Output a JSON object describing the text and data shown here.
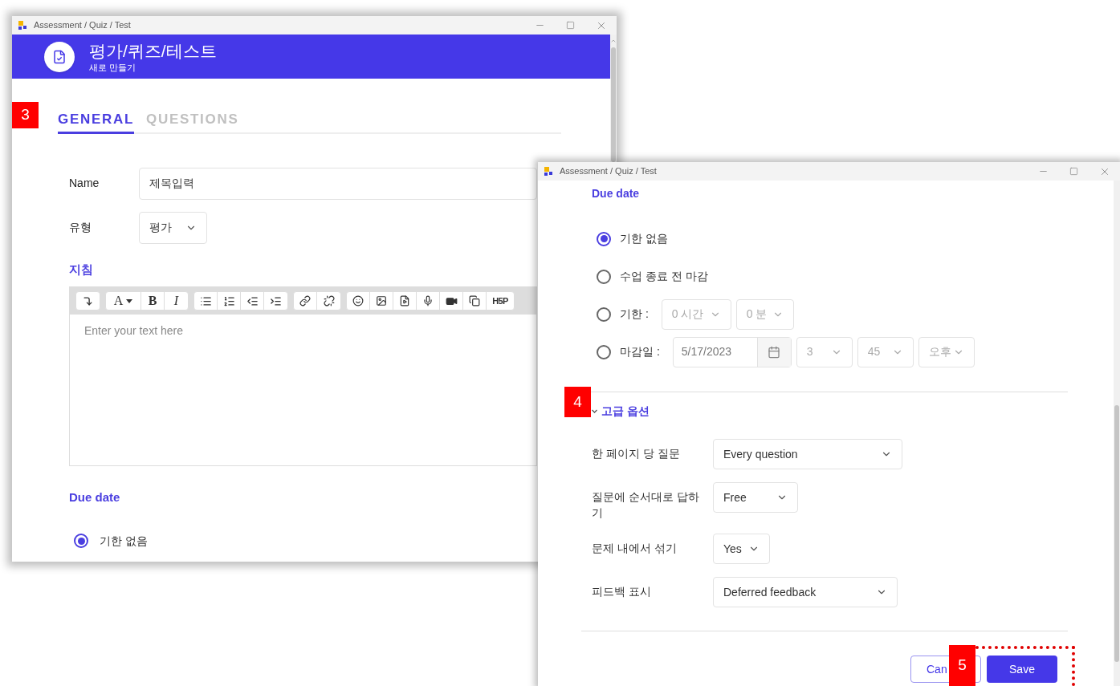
{
  "back_window": {
    "title": "Assessment / Quiz / Test",
    "header": {
      "title": "평가/퀴즈/테스트",
      "subtitle": "새로 만들기"
    },
    "tabs": [
      {
        "label": "GENERAL",
        "selected": true
      },
      {
        "label": "QUESTIONS",
        "selected": false
      }
    ],
    "fields": [
      {
        "label": "Name",
        "kind": "text",
        "value": "제목입력"
      },
      {
        "label": "유형",
        "kind": "select",
        "value": "평가"
      }
    ],
    "instructions": {
      "heading": "지침",
      "toolbar_labels": [
        "A",
        "B",
        "I",
        "H5P"
      ],
      "placeholder": "Enter your text here"
    },
    "due_date": {
      "heading": "Due date",
      "options": [
        {
          "label": "기한 없음",
          "selected": true
        }
      ]
    }
  },
  "front_window": {
    "title": "Assessment / Quiz / Test",
    "due_date": {
      "heading": "Due date",
      "options": [
        {
          "label": "기한 없음",
          "selected": true,
          "kind": "plain"
        },
        {
          "label": "수업 종료 전 마감",
          "selected": false,
          "kind": "plain"
        },
        {
          "label": "기한 :",
          "selected": false,
          "kind": "duration",
          "selects": [
            "0 시간",
            "0 분"
          ]
        },
        {
          "label": "마감일 :",
          "selected": false,
          "kind": "date",
          "date": "5/17/2023",
          "selects": [
            "3",
            "45",
            "오후"
          ]
        }
      ]
    },
    "advanced": {
      "heading": "고급 옵션",
      "expanded": true,
      "rows": [
        {
          "label": "한 페이지 당 질문",
          "value": "Every question"
        },
        {
          "label": "질문에 순서대로 답하기",
          "value": "Free"
        },
        {
          "label": "문제 내에서 섞기",
          "value": "Yes"
        },
        {
          "label": "피드백 표시",
          "value": "Deferred feedback"
        }
      ]
    },
    "buttons": [
      {
        "label": "Can",
        "kind": "secondary"
      },
      {
        "label": "Save",
        "kind": "primary"
      }
    ]
  },
  "callouts": [
    {
      "label": "3"
    },
    {
      "label": "4"
    },
    {
      "label": "5"
    }
  ]
}
